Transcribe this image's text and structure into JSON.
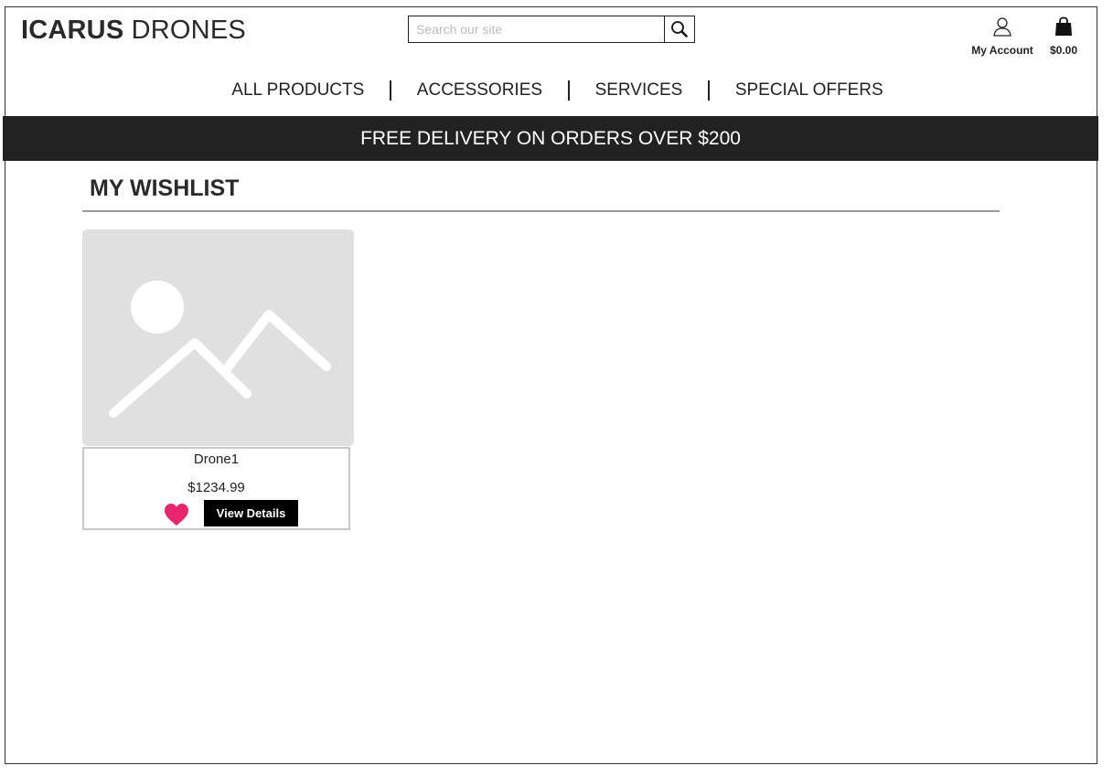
{
  "header": {
    "logo_bold": "ICARUS",
    "logo_light": "DRONES",
    "search_placeholder": "Search our site",
    "account_label": "My Account",
    "cart_total": "$0.00"
  },
  "nav": {
    "items": [
      "ALL PRODUCTS",
      "ACCESSORIES",
      "SERVICES",
      "SPECIAL OFFERS"
    ]
  },
  "banner": "FREE DELIVERY ON ORDERS OVER $200",
  "wishlist": {
    "title": "MY WISHLIST",
    "items": [
      {
        "name": "Drone1",
        "price": "$1234.99",
        "button_label": "View Details"
      }
    ]
  },
  "colors": {
    "heart": "#e8256e",
    "banner_bg": "#222222",
    "button_bg": "#000000"
  }
}
